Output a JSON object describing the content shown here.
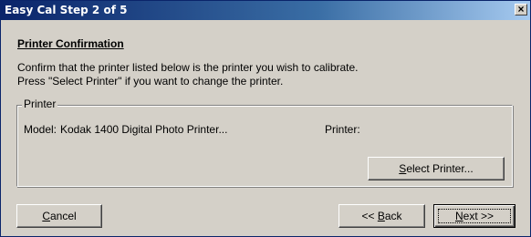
{
  "window": {
    "title": "Easy Cal Step 2 of 5",
    "close_glyph": "×",
    "close_icon": "close-icon"
  },
  "content": {
    "heading": "Printer Confirmation",
    "line1": "Confirm that the printer listed below is the printer you wish to calibrate.",
    "line2": "Press \"Select Printer\" if you want to change the printer."
  },
  "printer_group": {
    "legend": "Printer",
    "model_label": "Model:",
    "model_value": "Kodak 1400 Digital Photo Printer...",
    "printer_label": "Printer:",
    "select_button": {
      "mnemonic": "S",
      "rest": "elect Printer..."
    }
  },
  "buttons": {
    "cancel": {
      "mnemonic": "C",
      "rest": "ancel"
    },
    "back": {
      "prefix": "<< ",
      "mnemonic": "B",
      "rest": "ack"
    },
    "next": {
      "mnemonic": "N",
      "rest": "ext >>"
    }
  },
  "colors": {
    "titlebar_start": "#0a246a",
    "titlebar_end": "#a6caf0",
    "face": "#d4d0c8"
  }
}
